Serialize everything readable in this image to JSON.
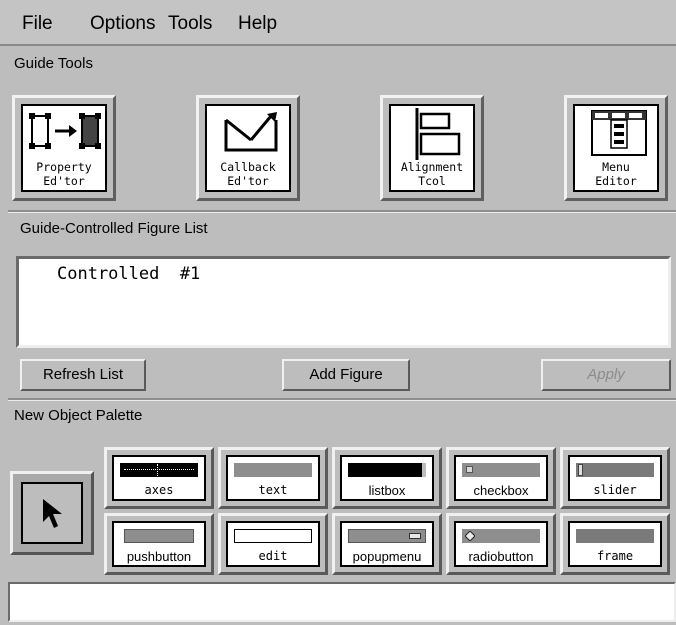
{
  "menubar": {
    "items": [
      "File",
      "Options",
      "Tools",
      "Help"
    ]
  },
  "guide_tools": {
    "title": "Guide Tools",
    "tools": [
      {
        "line1": "Property",
        "line2": "Ed'tor"
      },
      {
        "line1": "Callback",
        "line2": "Ed'tor"
      },
      {
        "line1": "Alignment",
        "line2": "Tcol"
      },
      {
        "line1": "Menu",
        "line2": "Editor"
      }
    ]
  },
  "figure_list": {
    "title": "Guide-Controlled Figure List",
    "entries": [
      "Controlled  #1"
    ],
    "refresh_label": "Refresh List",
    "add_label": "Add Figure",
    "apply_label": "Apply"
  },
  "palette": {
    "title": "New Object Palette",
    "items": [
      "axes",
      "text",
      "listbox",
      "checkbox",
      "slider",
      "pushbutton",
      "edit",
      "popupmenu",
      "radiobutton",
      "frame"
    ]
  }
}
